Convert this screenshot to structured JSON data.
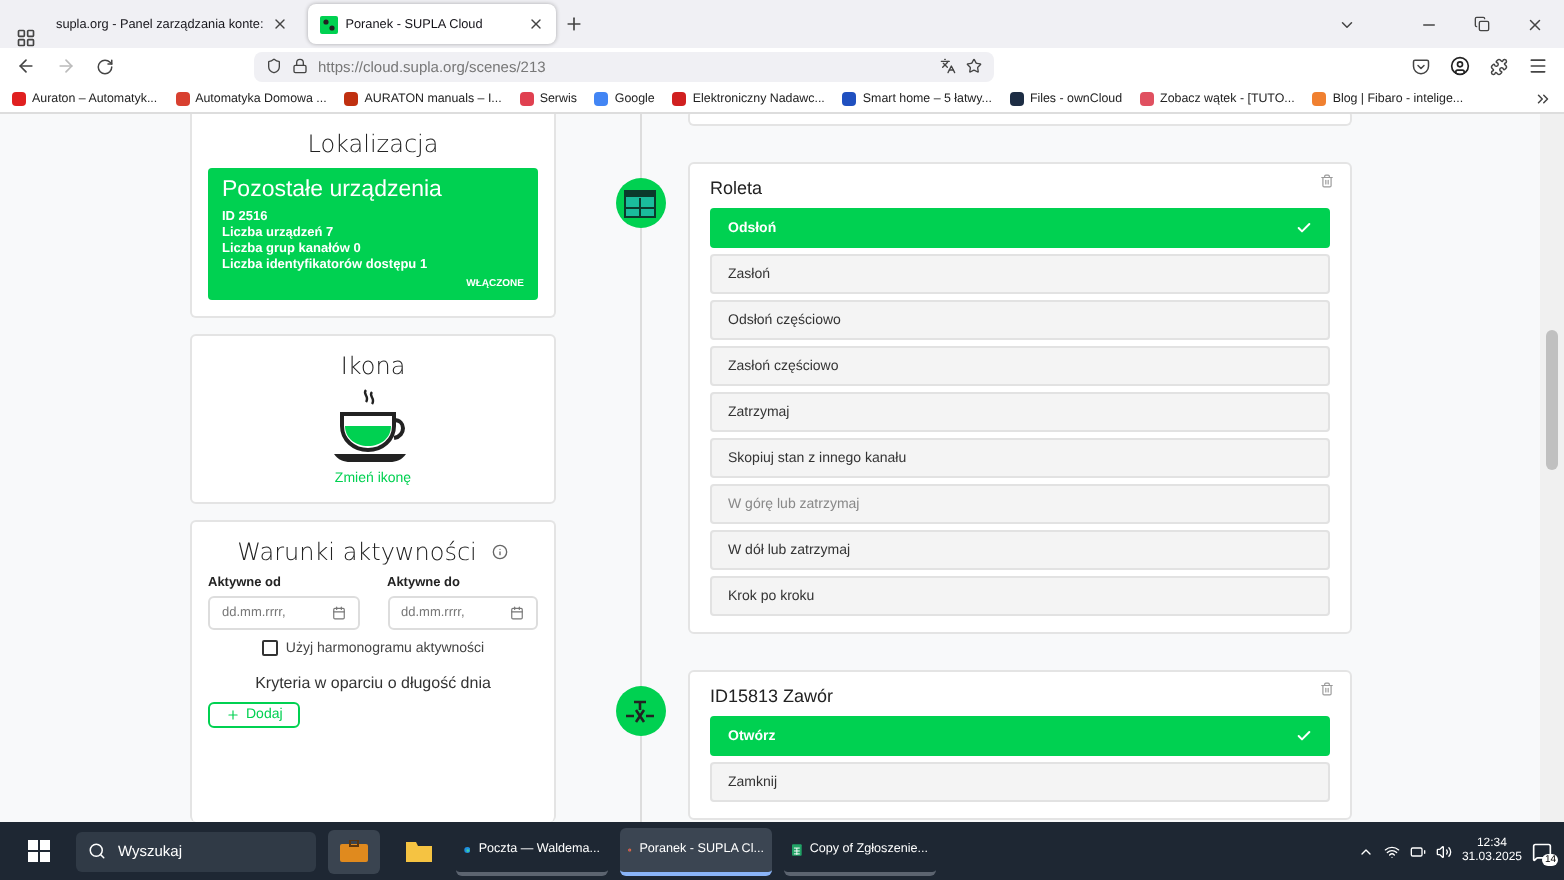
{
  "browser": {
    "tabs": [
      {
        "title": "supla.org - Panel zarządzania konte:",
        "selected": false
      },
      {
        "title": "Poranek - SUPLA Cloud",
        "selected": true
      }
    ],
    "url": "https://cloud.supla.org/scenes/213",
    "bookmarks": [
      {
        "label": "Auraton – Automatyk...",
        "color": "#e02020"
      },
      {
        "label": "Automatyka Domowa ...",
        "color": "#d84030"
      },
      {
        "label": "AURATON manuals – I...",
        "color": "#c03010"
      },
      {
        "label": "Serwis",
        "color": "#e04050"
      },
      {
        "label": "Google",
        "color": "#4285f4"
      },
      {
        "label": "Elektroniczny Nadawc...",
        "color": "#d02020"
      },
      {
        "label": "Smart home – 5 łatwy...",
        "color": "#2050c0"
      },
      {
        "label": "Files - ownCloud",
        "color": "#1d2d44"
      },
      {
        "label": "Zobacz wątek - [TUTO...",
        "color": "#e05060"
      },
      {
        "label": "Blog | Fibaro - intelige...",
        "color": "#f08030"
      }
    ]
  },
  "location": {
    "heading": "Lokalizacja",
    "tile": {
      "title": "Pozostałe urządzenia",
      "lines": [
        "ID 2516",
        "Liczba urządzeń 7",
        "Liczba grup kanałów 0",
        "Liczba identyfikatorów dostępu 1"
      ],
      "status": "WŁĄCZONE"
    }
  },
  "icon_card": {
    "heading": "Ikona",
    "link": "Zmień ikonę"
  },
  "conditions": {
    "heading": "Warunki aktywności",
    "fields": [
      {
        "label": "Aktywne od",
        "placeholder": "dd.mm.rrrr,"
      },
      {
        "label": "Aktywne do",
        "placeholder": "dd.mm.rrrr,"
      }
    ],
    "schedule": {
      "label": "Użyj harmonogramu aktywności",
      "checked": false
    },
    "criteria": "Kryteria w oparciu o długość dnia",
    "add_button": "Dodaj"
  },
  "steps": [
    {
      "kind": "shutter",
      "title": "Roleta",
      "actions": [
        {
          "label": "Odsłoń",
          "selected": true,
          "disabled": false
        },
        {
          "label": "Zasłoń",
          "selected": false,
          "disabled": false
        },
        {
          "label": "Odsłoń częściowo",
          "selected": false,
          "disabled": false
        },
        {
          "label": "Zasłoń częściowo",
          "selected": false,
          "disabled": false
        },
        {
          "label": "Zatrzymaj",
          "selected": false,
          "disabled": false
        },
        {
          "label": "Skopiuj stan z innego kanału",
          "selected": false,
          "disabled": false
        },
        {
          "label": "W górę lub zatrzymaj",
          "selected": false,
          "disabled": true
        },
        {
          "label": "W dół lub zatrzymaj",
          "selected": false,
          "disabled": false
        },
        {
          "label": "Krok po kroku",
          "selected": false,
          "disabled": false
        }
      ]
    },
    {
      "kind": "valve",
      "title": "ID15813 Zawór",
      "actions": [
        {
          "label": "Otwórz",
          "selected": true,
          "disabled": false
        },
        {
          "label": "Zamknij",
          "selected": false,
          "disabled": false
        }
      ]
    }
  ],
  "taskbar": {
    "search_placeholder": "Wyszukaj",
    "apps": [
      {
        "kind": "mail",
        "label": "Poczta — Waldema...",
        "selected": false
      },
      {
        "kind": "firefox",
        "label": "Poranek - SUPLA Cl...",
        "selected": true
      },
      {
        "kind": "sheet",
        "label": "Copy of Zgłoszenie...",
        "selected": false
      }
    ],
    "time": "12:34",
    "date": "31.03.2025",
    "notifications": "14"
  }
}
